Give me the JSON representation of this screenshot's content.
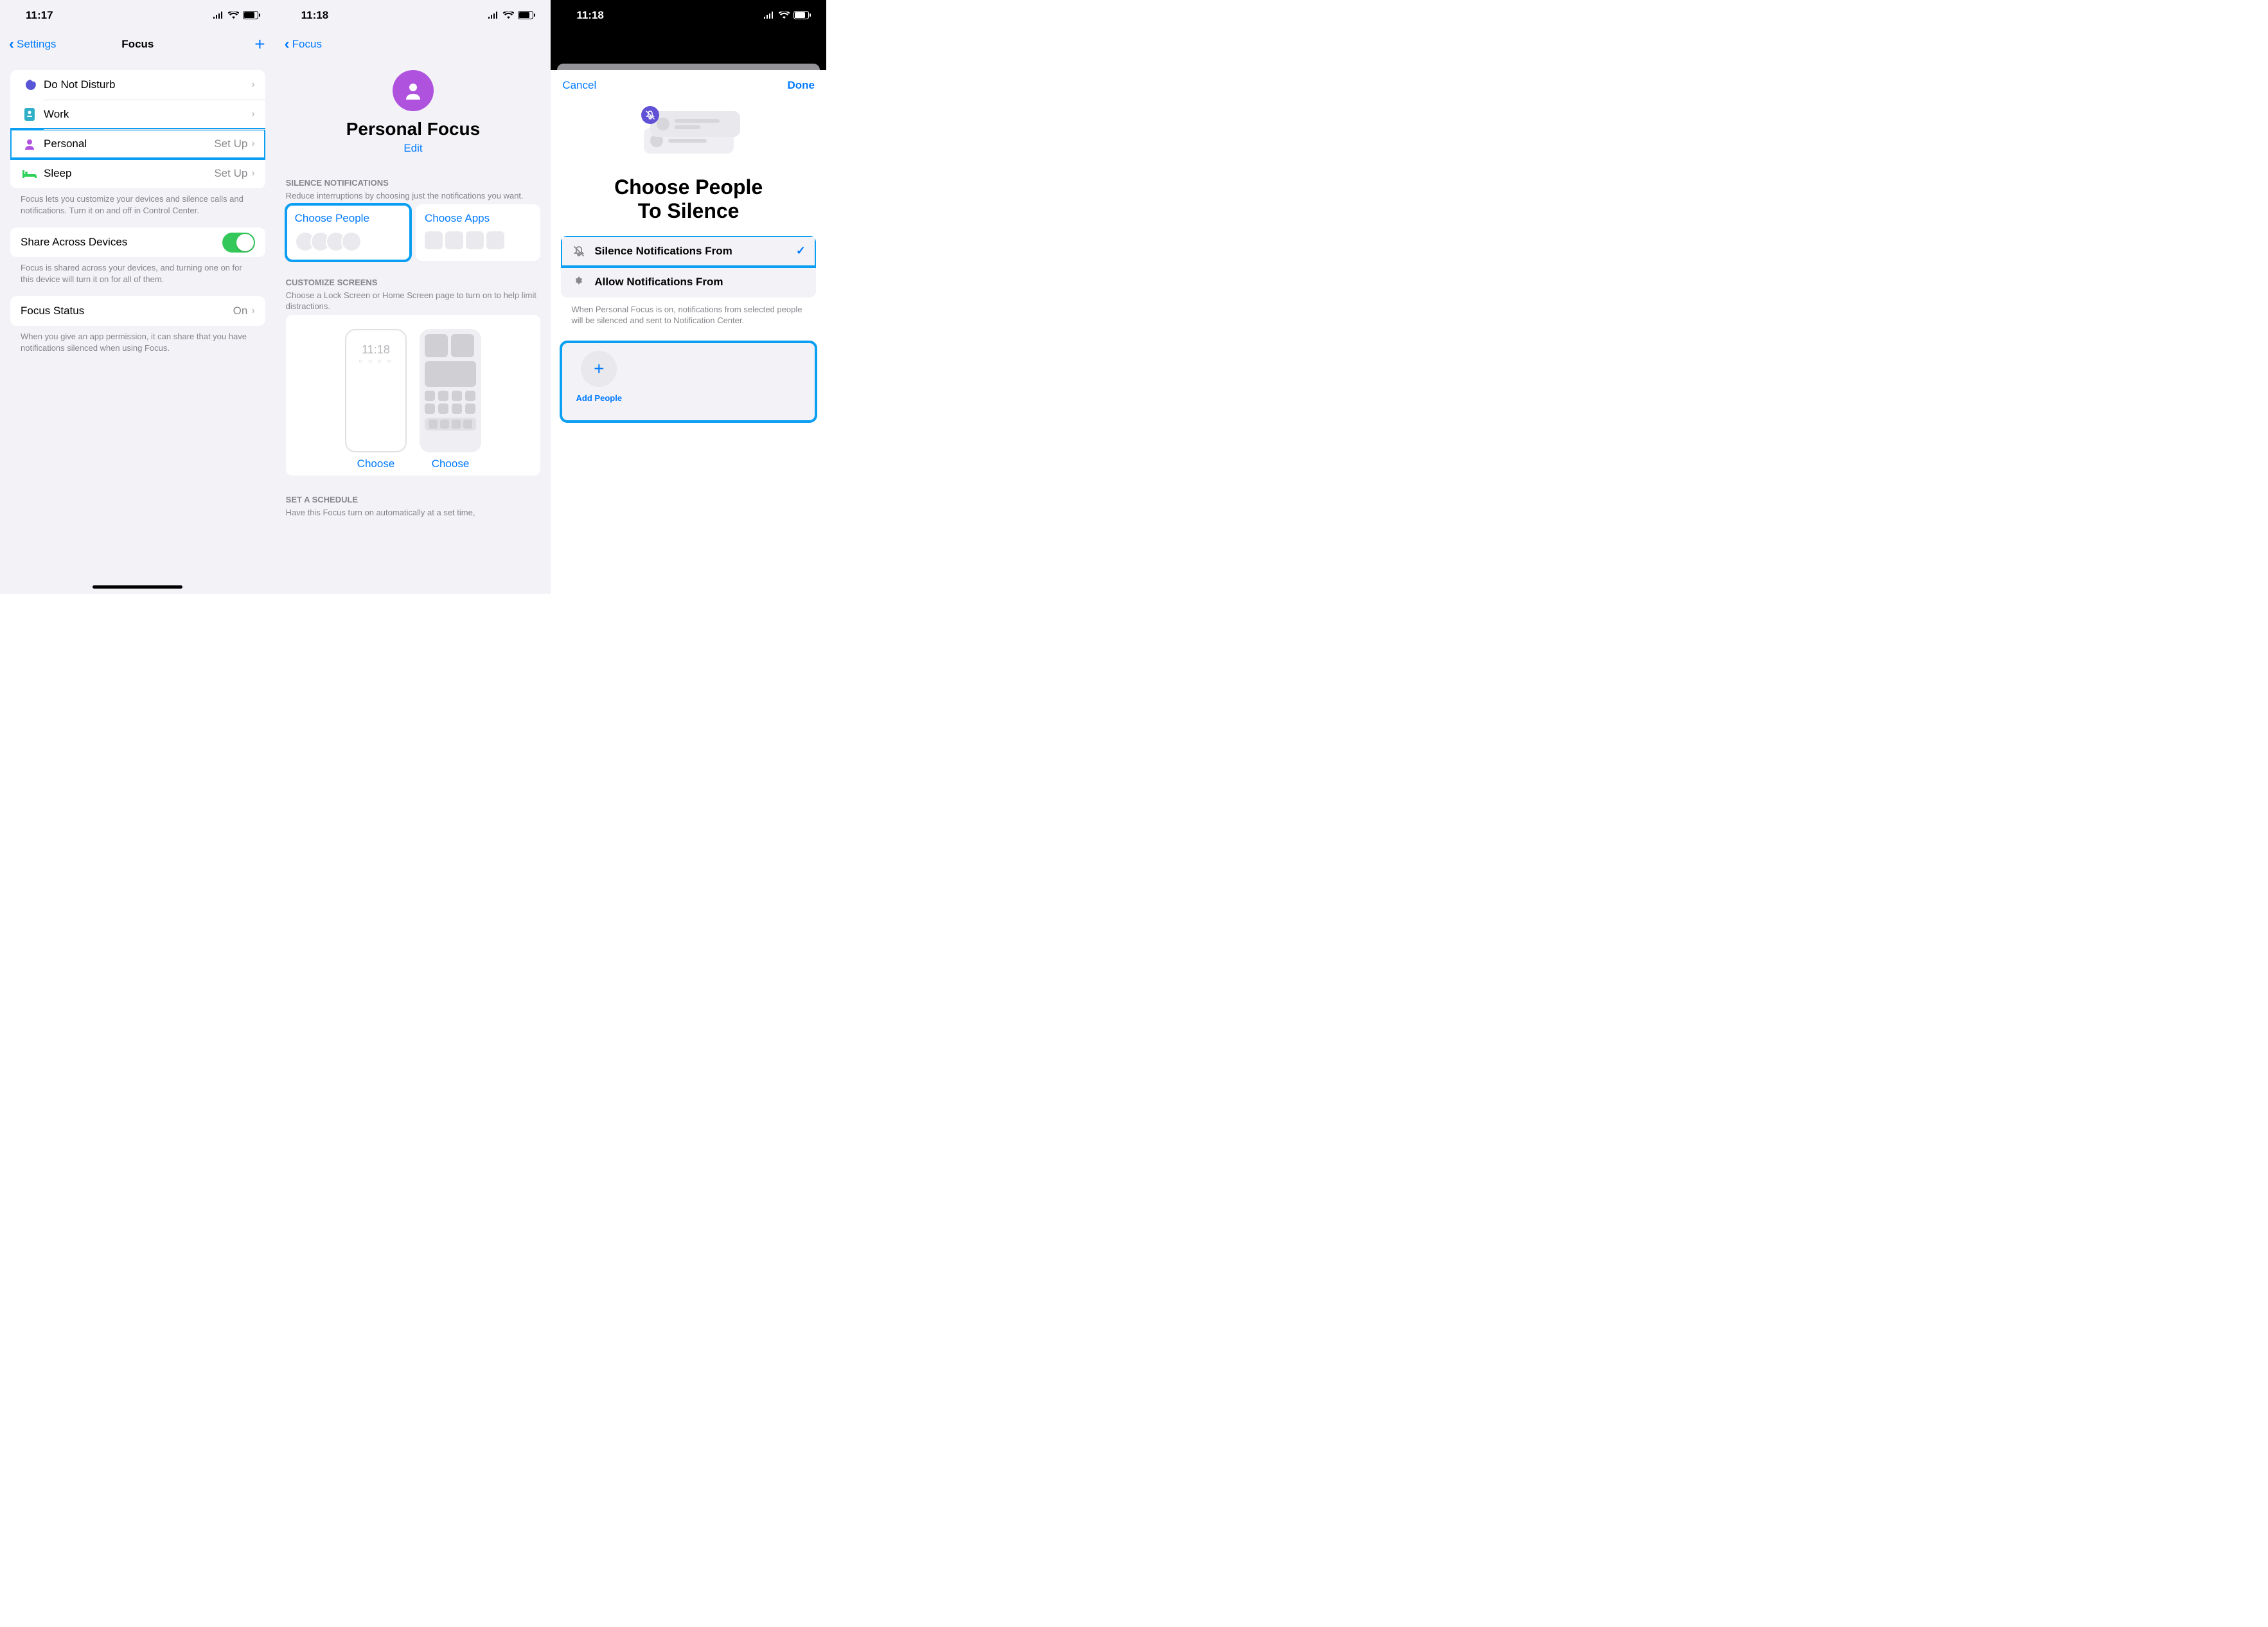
{
  "screen1": {
    "time": "11:17",
    "nav": {
      "back": "Settings",
      "title": "Focus"
    },
    "focus_modes": [
      {
        "icon": "moon",
        "label": "Do Not Disturb",
        "detail": ""
      },
      {
        "icon": "badge",
        "label": "Work",
        "detail": ""
      },
      {
        "icon": "person",
        "label": "Personal",
        "detail": "Set Up",
        "highlight": true
      },
      {
        "icon": "bed",
        "label": "Sleep",
        "detail": "Set Up"
      }
    ],
    "footer1": "Focus lets you customize your devices and silence calls and notifications. Turn it on and off in Control Center.",
    "share_row": {
      "label": "Share Across Devices",
      "on": true
    },
    "footer2": "Focus is shared across your devices, and turning one on for this device will turn it on for all of them.",
    "status_row": {
      "label": "Focus Status",
      "detail": "On"
    },
    "footer3": "When you give an app permission, it can share that you have notifications silenced when using Focus."
  },
  "screen2": {
    "time": "11:18",
    "nav": {
      "back": "Focus"
    },
    "header": {
      "title": "Personal Focus",
      "edit": "Edit"
    },
    "silence": {
      "header": "SILENCE NOTIFICATIONS",
      "sub": "Reduce interruptions by choosing just the notifications you want.",
      "people": "Choose People",
      "apps": "Choose Apps"
    },
    "customize": {
      "header": "CUSTOMIZE SCREENS",
      "sub": "Choose a Lock Screen or Home Screen page to turn on to help limit distractions.",
      "lock_time": "11:18",
      "choose": "Choose"
    },
    "schedule": {
      "header": "SET A SCHEDULE",
      "sub": "Have this Focus turn on automatically at a set time,"
    }
  },
  "screen3": {
    "time": "11:18",
    "cancel": "Cancel",
    "done": "Done",
    "title_l1": "Choose People",
    "title_l2": "To Silence",
    "opt1": "Silence Notifications From",
    "opt2": "Allow Notifications From",
    "footer": "When Personal Focus is on, notifications from selected people will be silenced and sent to Notification Center.",
    "add": "Add People"
  }
}
